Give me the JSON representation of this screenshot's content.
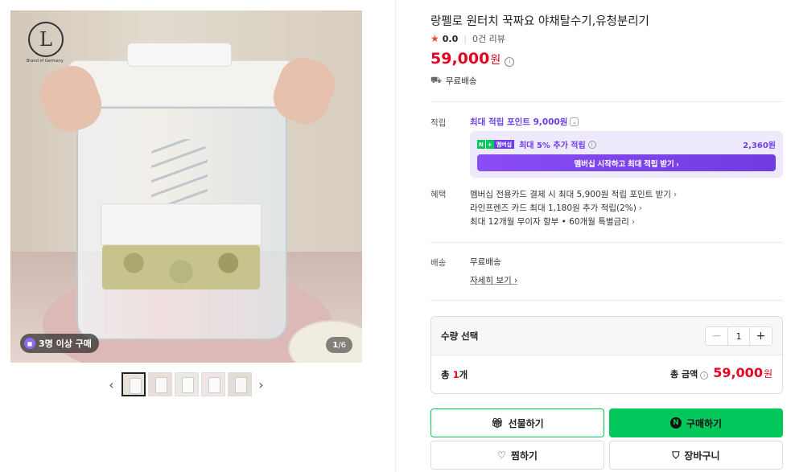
{
  "gallery": {
    "logo_letter": "L",
    "logo_sub": "Brand of Germany",
    "badge_text": "3명 이상 구매",
    "image_counter_current": "1",
    "image_counter_sep": "/",
    "image_counter_total": "6",
    "prev_arrow": "‹",
    "next_arrow": "›",
    "thumbnail_count": 5,
    "active_thumbnail": 1
  },
  "product": {
    "title": "랑펠로 원터치 꾹짜요 야채탈수기,유청분리기",
    "rating_score": "0.0",
    "review_count": "0건 리뷰",
    "price": "59,000",
    "price_unit": "원",
    "shipping_top": "무료배송"
  },
  "points": {
    "label": "적립",
    "max_points": "최대 적립 포인트 9,000원",
    "np_n": "N",
    "np_plus": "+",
    "np_member": "멤버십",
    "extra_text": "최대 5% 추가 적립",
    "extra_amount": "2,360원",
    "membership_button": "멤버십 시작하고 최대 적립 받기 ›"
  },
  "benefits": {
    "label": "혜택",
    "items": [
      "멤버십 전용카드 결제 시 최대 5,900원 적립 포인트 받기",
      "라인프렌즈 카드 최대 1,180원 추가 적립(2%)",
      "최대 12개월 무이자 할부 • 60개월 특별금리"
    ]
  },
  "delivery": {
    "label": "배송",
    "value": "무료배송",
    "detail_link": "자세히 보기"
  },
  "quantity": {
    "label": "수량 선택",
    "minus": "−",
    "plus": "+",
    "value": "1",
    "total_count_prefix": "총 ",
    "total_count_num": "1",
    "total_count_suffix": "개",
    "total_label": "총 금액",
    "total_price": "59,000",
    "total_unit": "원"
  },
  "actions": {
    "gift": "선물하기",
    "buy": "구매하기",
    "wish": "찜하기",
    "cart": "장바구니"
  },
  "colors": {
    "price_red": "#e30521",
    "naver_green": "#03c75a",
    "membership_purple": "#6d3ee8"
  }
}
